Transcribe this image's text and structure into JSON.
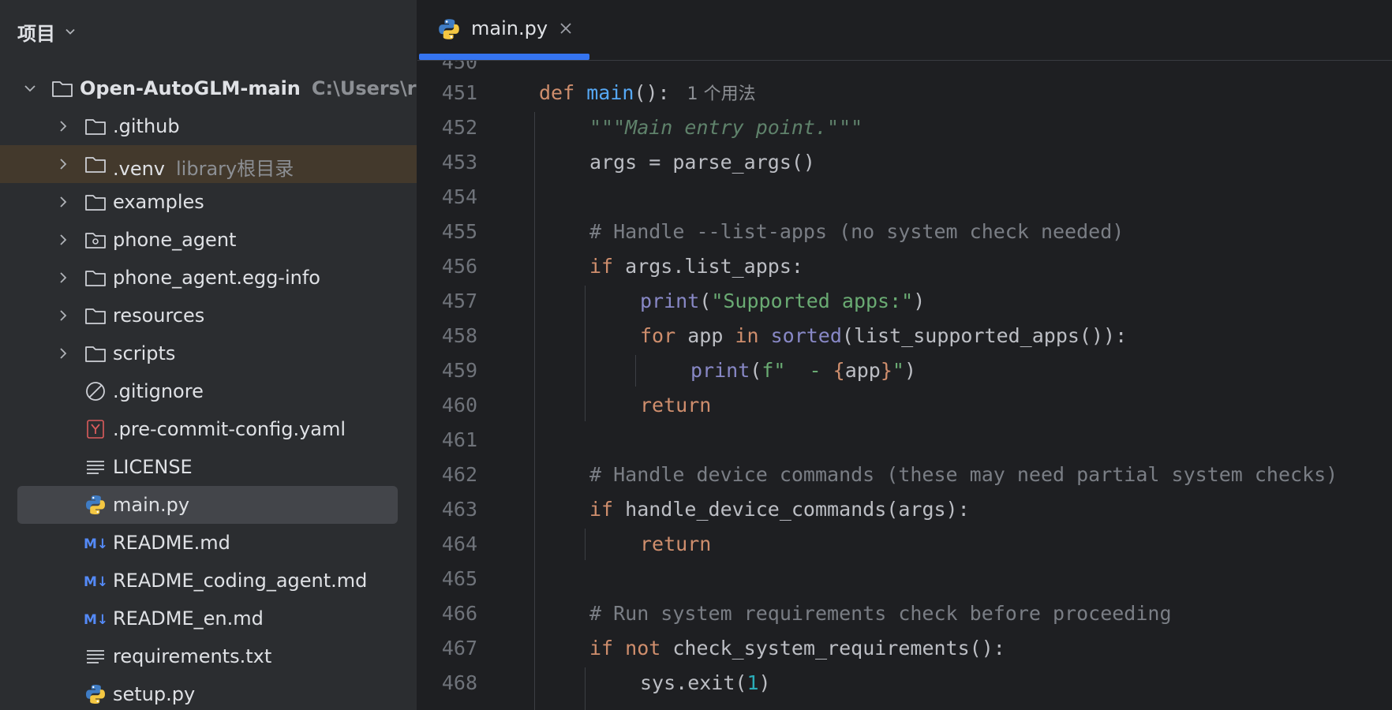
{
  "sidebar": {
    "title": "项目",
    "tree": [
      {
        "label": "Open-AutoGLM-main",
        "hint": "C:\\Users\\ruiye",
        "icon": "folder-icon",
        "arrow": "expanded",
        "depth": 0,
        "bold": true
      },
      {
        "label": ".github",
        "icon": "folder-icon",
        "arrow": "collapsed",
        "depth": 1
      },
      {
        "label": ".venv",
        "hint": "library根目录",
        "icon": "folder-icon",
        "arrow": "collapsed",
        "depth": 1,
        "highlight": true
      },
      {
        "label": "examples",
        "icon": "folder-icon",
        "arrow": "collapsed",
        "depth": 1
      },
      {
        "label": "phone_agent",
        "icon": "package-folder-icon",
        "arrow": "collapsed",
        "depth": 1
      },
      {
        "label": "phone_agent.egg-info",
        "icon": "folder-icon",
        "arrow": "collapsed",
        "depth": 1
      },
      {
        "label": "resources",
        "icon": "folder-icon",
        "arrow": "collapsed",
        "depth": 1
      },
      {
        "label": "scripts",
        "icon": "folder-icon",
        "arrow": "collapsed",
        "depth": 1
      },
      {
        "label": ".gitignore",
        "icon": "ignore-file-icon",
        "depth": 1
      },
      {
        "label": ".pre-commit-config.yaml",
        "icon": "yaml-file-icon",
        "depth": 1
      },
      {
        "label": "LICENSE",
        "icon": "text-file-icon",
        "depth": 1
      },
      {
        "label": "main.py",
        "icon": "python-file-icon",
        "depth": 1,
        "selected": true
      },
      {
        "label": "README.md",
        "icon": "markdown-file-icon",
        "depth": 1
      },
      {
        "label": "README_coding_agent.md",
        "icon": "markdown-file-icon",
        "depth": 1
      },
      {
        "label": "README_en.md",
        "icon": "markdown-file-icon",
        "depth": 1
      },
      {
        "label": "requirements.txt",
        "icon": "text-file-icon",
        "depth": 1
      },
      {
        "label": "setup.py",
        "icon": "python-file-icon",
        "depth": 1
      }
    ]
  },
  "editor": {
    "tab": {
      "label": "main.py",
      "icon": "python-file-icon"
    },
    "lines": [
      {
        "num": "451",
        "indent": 0,
        "tokens": [
          [
            "kw",
            "def "
          ],
          [
            "fn",
            "main"
          ],
          [
            "",
            "(): "
          ],
          [
            "usage",
            " 1 个用法"
          ]
        ]
      },
      {
        "num": "452",
        "indent": 1,
        "tokens": [
          [
            "doc",
            "\"\"\"Main entry point.\"\"\""
          ]
        ]
      },
      {
        "num": "453",
        "indent": 1,
        "tokens": [
          [
            "",
            "args = parse_args()"
          ]
        ]
      },
      {
        "num": "454",
        "indent": 1,
        "tokens": []
      },
      {
        "num": "455",
        "indent": 1,
        "tokens": [
          [
            "cm",
            "# Handle --list-apps (no system check needed)"
          ]
        ]
      },
      {
        "num": "456",
        "indent": 1,
        "tokens": [
          [
            "kw",
            "if "
          ],
          [
            "",
            "args.list_apps:"
          ]
        ]
      },
      {
        "num": "457",
        "indent": 2,
        "tokens": [
          [
            "bi",
            "print"
          ],
          [
            "",
            "("
          ],
          [
            "str",
            "\"Supported apps:\""
          ],
          [
            "",
            ")"
          ]
        ]
      },
      {
        "num": "458",
        "indent": 2,
        "tokens": [
          [
            "kw",
            "for "
          ],
          [
            "",
            "app "
          ],
          [
            "kw",
            "in "
          ],
          [
            "bi",
            "sorted"
          ],
          [
            "",
            "(list_supported_apps()):"
          ]
        ]
      },
      {
        "num": "459",
        "indent": 3,
        "tokens": [
          [
            "bi",
            "print"
          ],
          [
            "",
            "("
          ],
          [
            "str",
            "f\"  - "
          ],
          [
            "kw",
            "{"
          ],
          [
            "",
            "app"
          ],
          [
            "kw",
            "}"
          ],
          [
            "str",
            "\""
          ],
          [
            "",
            ")"
          ]
        ]
      },
      {
        "num": "460",
        "indent": 2,
        "tokens": [
          [
            "kw",
            "return"
          ]
        ]
      },
      {
        "num": "461",
        "indent": 1,
        "tokens": []
      },
      {
        "num": "462",
        "indent": 1,
        "tokens": [
          [
            "cm",
            "# Handle device commands (these may need partial system checks)"
          ]
        ]
      },
      {
        "num": "463",
        "indent": 1,
        "tokens": [
          [
            "kw",
            "if "
          ],
          [
            "",
            "handle_device_commands(args):"
          ]
        ]
      },
      {
        "num": "464",
        "indent": 2,
        "tokens": [
          [
            "kw",
            "return"
          ]
        ]
      },
      {
        "num": "465",
        "indent": 1,
        "tokens": []
      },
      {
        "num": "466",
        "indent": 1,
        "tokens": [
          [
            "cm",
            "# Run system requirements check before proceeding"
          ]
        ]
      },
      {
        "num": "467",
        "indent": 1,
        "tokens": [
          [
            "kw",
            "if "
          ],
          [
            "kw",
            "not "
          ],
          [
            "",
            "check_system_requirements():"
          ]
        ]
      },
      {
        "num": "468",
        "indent": 2,
        "tokens": [
          [
            "",
            "sys.exit("
          ],
          [
            "num",
            "1"
          ],
          [
            "",
            ")"
          ]
        ]
      }
    ]
  }
}
